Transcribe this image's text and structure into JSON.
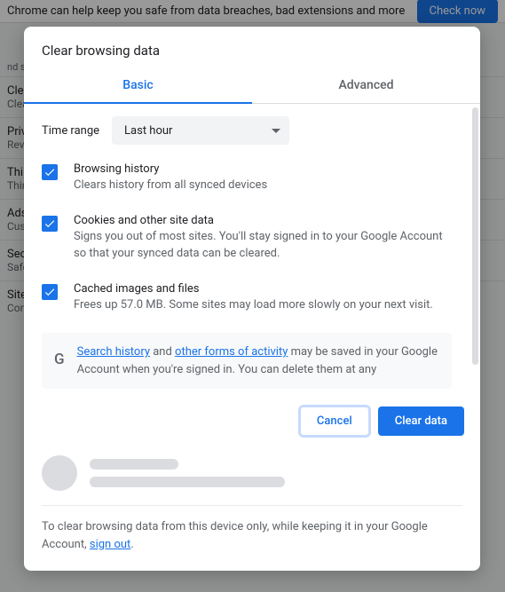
{
  "background": {
    "banner": "Chrome can help keep you safe from data breaches, bad extensions and more",
    "check_btn": "Check now",
    "section_label": "nd s",
    "rows": [
      {
        "title": "Clear browsing data",
        "sub": "Clear history, cookies, cache, and more"
      },
      {
        "title": "Privacy Sandbox",
        "sub": "Review your settings"
      },
      {
        "title": "Third-party cookies",
        "sub": "Third-party cookies are blocked in Incognito mode"
      },
      {
        "title": "Ads privacy",
        "sub": "Customize the info used by sites to show you ads"
      },
      {
        "title": "Security",
        "sub": "Safe Browsing (protection from dangerous sites) and other security settings"
      },
      {
        "title": "Site settings",
        "sub": "Controls what information sites can use and show"
      }
    ]
  },
  "dialog": {
    "title": "Clear browsing data",
    "tabs": {
      "basic": "Basic",
      "advanced": "Advanced"
    },
    "time_range_label": "Time range",
    "time_range_value": "Last hour",
    "options": [
      {
        "title": "Browsing history",
        "desc": "Clears history from all synced devices"
      },
      {
        "title": "Cookies and other site data",
        "desc": "Signs you out of most sites. You'll stay signed in to your Google Account so that your synced data can be cleared."
      },
      {
        "title": "Cached images and files",
        "desc": "Frees up 57.0 MB. Some sites may load more slowly on your next visit."
      }
    ],
    "info": {
      "link1": "Search history",
      "mid1": " and ",
      "link2": "other forms of activity",
      "rest": " may be saved in your Google Account when you're signed in. You can delete them at any"
    },
    "cancel": "Cancel",
    "clear": "Clear data",
    "footer_pre": "To clear browsing data from this device only, while keeping it in your Google Account, ",
    "footer_link": "sign out",
    "footer_post": "."
  }
}
